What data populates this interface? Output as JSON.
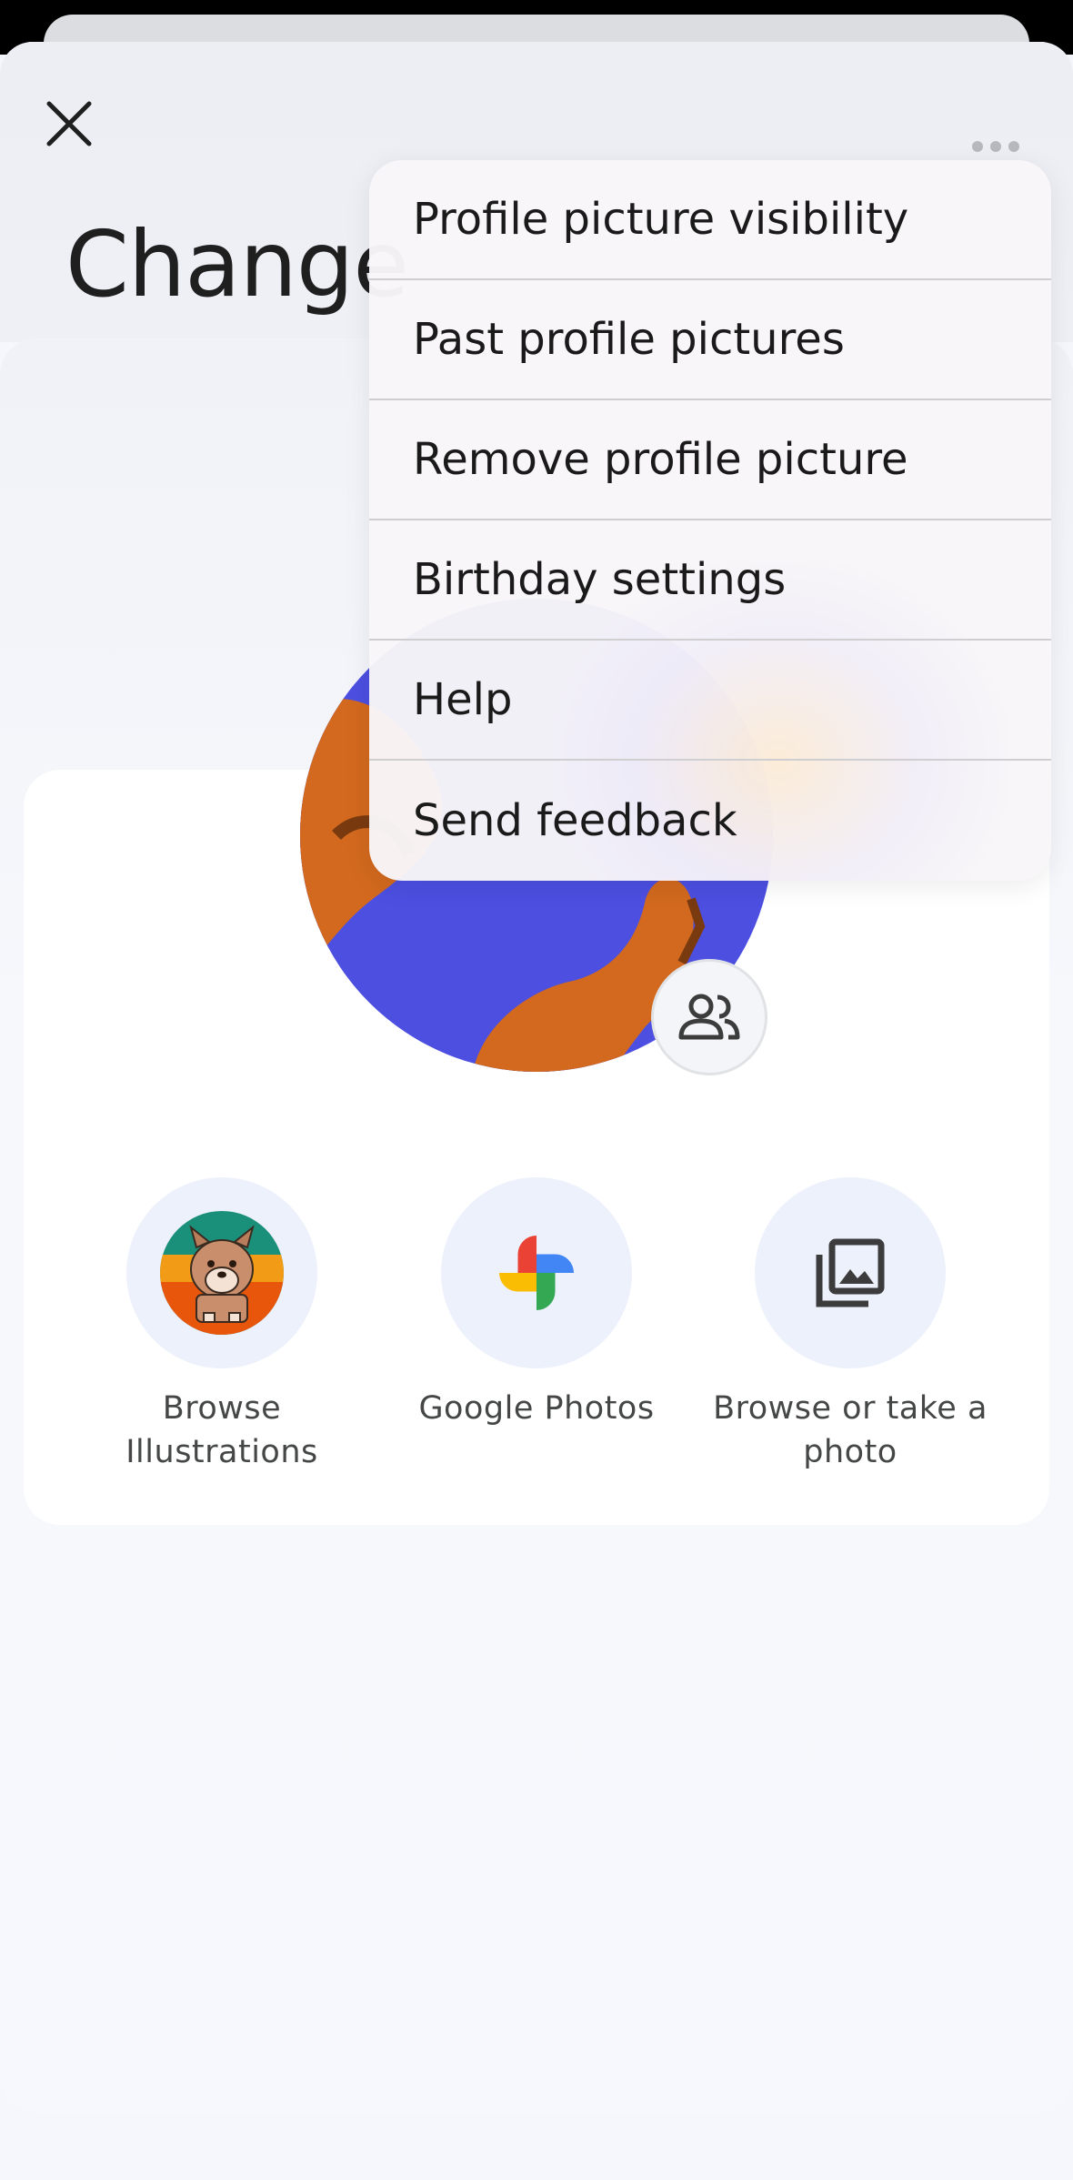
{
  "header": {
    "title": "Change",
    "close_icon": "close-icon",
    "more_icon": "more-horizontal-icon"
  },
  "avatar": {
    "share_icon": "people-icon"
  },
  "actions": [
    {
      "label_line1": "Browse",
      "label_line2": "Illustrations",
      "icon": "illustration-dog-icon"
    },
    {
      "label_line1": "Google Photos",
      "label_line2": "",
      "icon": "google-photos-pinwheel-icon"
    },
    {
      "label_line1": "Browse or take a",
      "label_line2": "photo",
      "icon": "photo-library-icon"
    }
  ],
  "menu": {
    "items": [
      {
        "label": "Profile picture visibility"
      },
      {
        "label": "Past profile pictures"
      },
      {
        "label": "Remove profile picture"
      },
      {
        "label": "Birthday settings"
      },
      {
        "label": "Help"
      },
      {
        "label": "Send feedback"
      }
    ]
  },
  "colors": {
    "avatar_blue": "#4c4fe0",
    "avatar_orange": "#d2691e",
    "accent_blue": "#4285f4"
  }
}
